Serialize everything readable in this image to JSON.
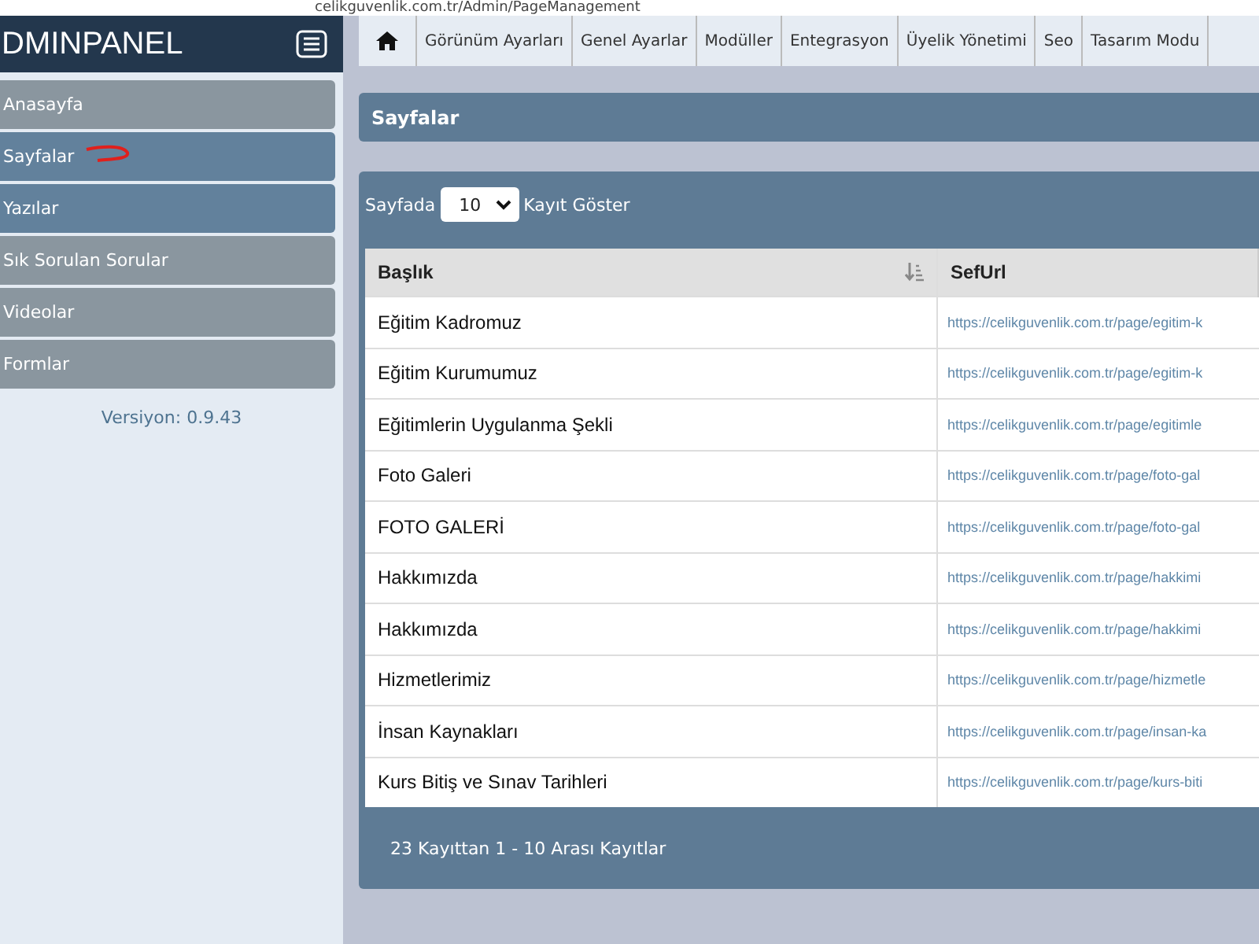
{
  "browser": {
    "url": "celikguvenlik.com.tr/Admin/PageManagement"
  },
  "sidebar": {
    "brand": "DMINPANEL",
    "items": [
      {
        "label": "Anasayfa",
        "selected": false
      },
      {
        "label": "Sayfalar",
        "selected": true
      },
      {
        "label": "Yazılar",
        "selected": true
      },
      {
        "label": "Sık Sorulan Sorular",
        "selected": false
      },
      {
        "label": "Videolar",
        "selected": false
      },
      {
        "label": "Formlar",
        "selected": false
      }
    ],
    "version": "Versiyon: 0.9.43"
  },
  "topnav": {
    "tabs": [
      "Görünüm Ayarları",
      "Genel Ayarlar",
      "Modüller",
      "Entegrasyon",
      "Üyelik Yönetimi",
      "Seo",
      "Tasarım Modu"
    ]
  },
  "page_header": "Sayfalar",
  "table": {
    "length_prefix": "Sayfada",
    "length_value": "10",
    "length_suffix": "Kayıt Göster",
    "columns": [
      "Başlık",
      "SefUrl"
    ],
    "rows": [
      [
        "Eğitim Kadromuz",
        "https://celikguvenlik.com.tr/page/egitim-k"
      ],
      [
        "Eğitim Kurumumuz",
        "https://celikguvenlik.com.tr/page/egitim-k"
      ],
      [
        "Eğitimlerin Uygulanma Şekli",
        "https://celikguvenlik.com.tr/page/egitimle"
      ],
      [
        "Foto Galeri",
        "https://celikguvenlik.com.tr/page/foto-gal"
      ],
      [
        "FOTO GALERİ",
        "https://celikguvenlik.com.tr/page/foto-gal"
      ],
      [
        "Hakkımızda",
        "https://celikguvenlik.com.tr/page/hakkimi"
      ],
      [
        "Hakkımızda",
        "https://celikguvenlik.com.tr/page/hakkimi"
      ],
      [
        "Hizmetlerimiz",
        "https://celikguvenlik.com.tr/page/hizmetle"
      ],
      [
        "İnsan Kaynakları",
        "https://celikguvenlik.com.tr/page/insan-ka"
      ],
      [
        "Kurs Bitiş ve Sınav Tarihleri",
        "https://celikguvenlik.com.tr/page/kurs-biti"
      ]
    ],
    "info": "23 Kayıttan 1 - 10 Arası Kayıtlar"
  }
}
